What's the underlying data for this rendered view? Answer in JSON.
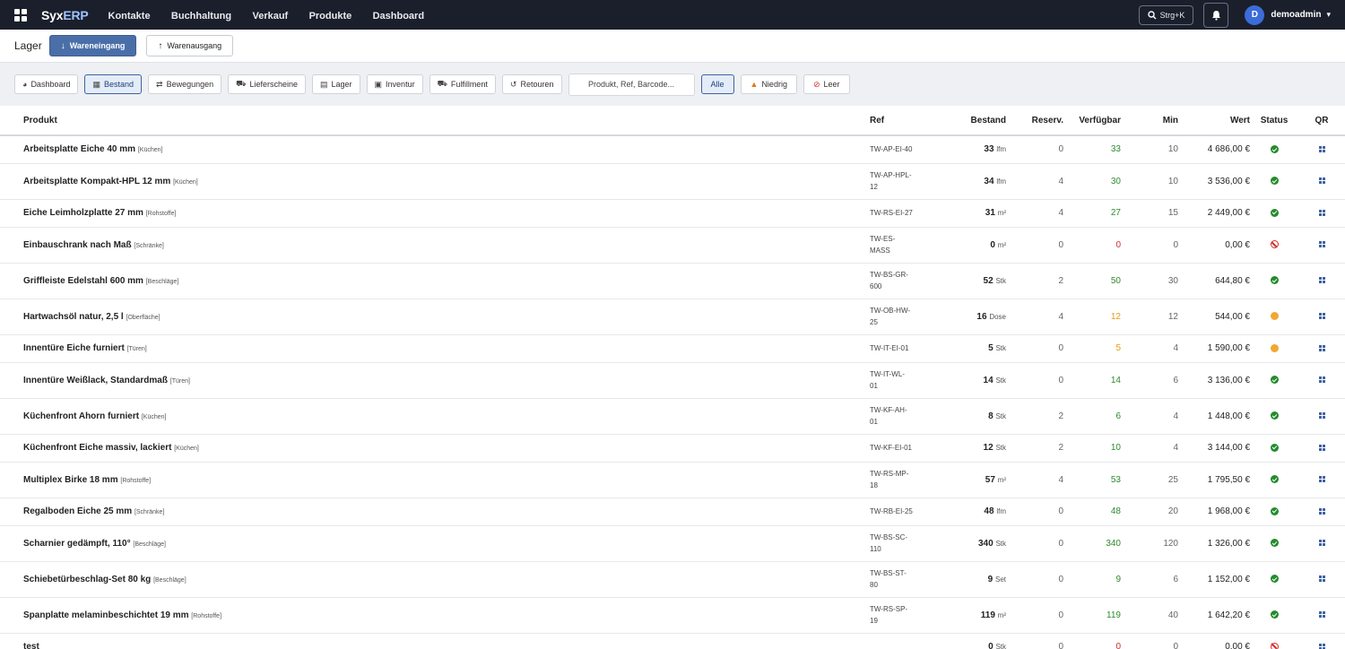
{
  "app": {
    "brand_a": "Syx",
    "brand_b": "ERP",
    "nav": [
      "Kontakte",
      "Buchhaltung",
      "Verkauf",
      "Produkte",
      "Dashboard"
    ],
    "search_label": "Strg+K",
    "avatar_initial": "D",
    "username": "demoadmin"
  },
  "page": {
    "title": "Lager",
    "btn_in": "Wareneingang",
    "btn_out": "Warenausgang"
  },
  "tabs": [
    "Dashboard",
    "Bestand",
    "Bewegungen",
    "Lieferscheine",
    "Lager",
    "Inventur",
    "Fulfillment",
    "Retouren"
  ],
  "active_tab": "Bestand",
  "search": {
    "placeholder": "Produkt, Ref, Barcode..."
  },
  "filters": [
    "Alle",
    "Niedrig",
    "Leer"
  ],
  "table": {
    "headers": {
      "product": "Produkt",
      "ref": "Ref",
      "stock": "Bestand",
      "reserved": "Reserv.",
      "available": "Verfügbar",
      "min": "Min",
      "value": "Wert",
      "status": "Status",
      "qr": "QR"
    },
    "rows": [
      {
        "name": "Arbeitsplatte Eiche 40 mm",
        "cat": "[Küchen]",
        "ref": [
          "TW-AP-EI-40"
        ],
        "stock": "33",
        "unit": "lfm",
        "reserved": "0",
        "available": "33",
        "min": "10",
        "value": "4 686,00 €",
        "status": "ok"
      },
      {
        "name": "Arbeitsplatte Kompakt-HPL 12 mm",
        "cat": "[Küchen]",
        "ref": [
          "TW-AP-HPL-",
          "12"
        ],
        "stock": "34",
        "unit": "lfm",
        "reserved": "4",
        "available": "30",
        "min": "10",
        "value": "3 536,00 €",
        "status": "ok"
      },
      {
        "name": "Eiche Leimholzplatte 27 mm",
        "cat": "[Rohstoffe]",
        "ref": [
          "TW-RS-EI-27"
        ],
        "stock": "31",
        "unit": "m²",
        "reserved": "4",
        "available": "27",
        "min": "15",
        "value": "2 449,00 €",
        "status": "ok"
      },
      {
        "name": "Einbauschrank nach Maß",
        "cat": "[Schränke]",
        "ref": [
          "TW-ES-",
          "MASS"
        ],
        "stock": "0",
        "unit": "m²",
        "reserved": "0",
        "available": "0",
        "min": "0",
        "value": "0,00 €",
        "status": "empty"
      },
      {
        "name": "Griffleiste Edelstahl 600 mm",
        "cat": "[Beschläge]",
        "ref": [
          "TW-BS-GR-",
          "600"
        ],
        "stock": "52",
        "unit": "Stk",
        "reserved": "2",
        "available": "50",
        "min": "30",
        "value": "644,80 €",
        "status": "ok"
      },
      {
        "name": "Hartwachsöl natur, 2,5 l",
        "cat": "[Oberfläche]",
        "ref": [
          "TW-OB-HW-",
          "25"
        ],
        "stock": "16",
        "unit": "Dose",
        "reserved": "4",
        "available": "12",
        "min": "12",
        "value": "544,00 €",
        "status": "low"
      },
      {
        "name": "Innentüre Eiche furniert",
        "cat": "[Türen]",
        "ref": [
          "TW-IT-EI-01"
        ],
        "stock": "5",
        "unit": "Stk",
        "reserved": "0",
        "available": "5",
        "min": "4",
        "value": "1 590,00 €",
        "status": "low"
      },
      {
        "name": "Innentüre Weißlack, Standardmaß",
        "cat": "[Türen]",
        "ref": [
          "TW-IT-WL-",
          "01"
        ],
        "stock": "14",
        "unit": "Stk",
        "reserved": "0",
        "available": "14",
        "min": "6",
        "value": "3 136,00 €",
        "status": "ok"
      },
      {
        "name": "Küchenfront Ahorn furniert",
        "cat": "[Küchen]",
        "ref": [
          "TW-KF-AH-",
          "01"
        ],
        "stock": "8",
        "unit": "Stk",
        "reserved": "2",
        "available": "6",
        "min": "4",
        "value": "1 448,00 €",
        "status": "ok"
      },
      {
        "name": "Küchenfront Eiche massiv, lackiert",
        "cat": "[Küchen]",
        "ref": [
          "TW-KF-EI-01"
        ],
        "stock": "12",
        "unit": "Stk",
        "reserved": "2",
        "available": "10",
        "min": "4",
        "value": "3 144,00 €",
        "status": "ok"
      },
      {
        "name": "Multiplex Birke 18 mm",
        "cat": "[Rohstoffe]",
        "ref": [
          "TW-RS-MP-",
          "18"
        ],
        "stock": "57",
        "unit": "m²",
        "reserved": "4",
        "available": "53",
        "min": "25",
        "value": "1 795,50 €",
        "status": "ok"
      },
      {
        "name": "Regalboden Eiche 25 mm",
        "cat": "[Schränke]",
        "ref": [
          "TW-RB-EI-25"
        ],
        "stock": "48",
        "unit": "lfm",
        "reserved": "0",
        "available": "48",
        "min": "20",
        "value": "1 968,00 €",
        "status": "ok"
      },
      {
        "name": "Scharnier gedämpft, 110°",
        "cat": "[Beschläge]",
        "ref": [
          "TW-BS-SC-",
          "110"
        ],
        "stock": "340",
        "unit": "Stk",
        "reserved": "0",
        "available": "340",
        "min": "120",
        "value": "1 326,00 €",
        "status": "ok"
      },
      {
        "name": "Schiebetürbeschlag-Set 80 kg",
        "cat": "[Beschläge]",
        "ref": [
          "TW-BS-ST-",
          "80"
        ],
        "stock": "9",
        "unit": "Set",
        "reserved": "0",
        "available": "9",
        "min": "6",
        "value": "1 152,00 €",
        "status": "ok"
      },
      {
        "name": "Spanplatte melaminbeschichtet 19 mm",
        "cat": "[Rohstoffe]",
        "ref": [
          "TW-RS-SP-",
          "19"
        ],
        "stock": "119",
        "unit": "m²",
        "reserved": "0",
        "available": "119",
        "min": "40",
        "value": "1 642,20 €",
        "status": "ok"
      },
      {
        "name": "test",
        "cat": "",
        "ref": [
          ""
        ],
        "stock": "0",
        "unit": "Stk",
        "reserved": "0",
        "available": "0",
        "min": "0",
        "value": "0,00 €",
        "status": "empty"
      }
    ]
  },
  "colors": {
    "topbar": "#1a1f2b",
    "primary": "#4a6fa8",
    "ok": "#2f8a2f",
    "low": "#e69a17",
    "empty": "#d12b2b"
  }
}
